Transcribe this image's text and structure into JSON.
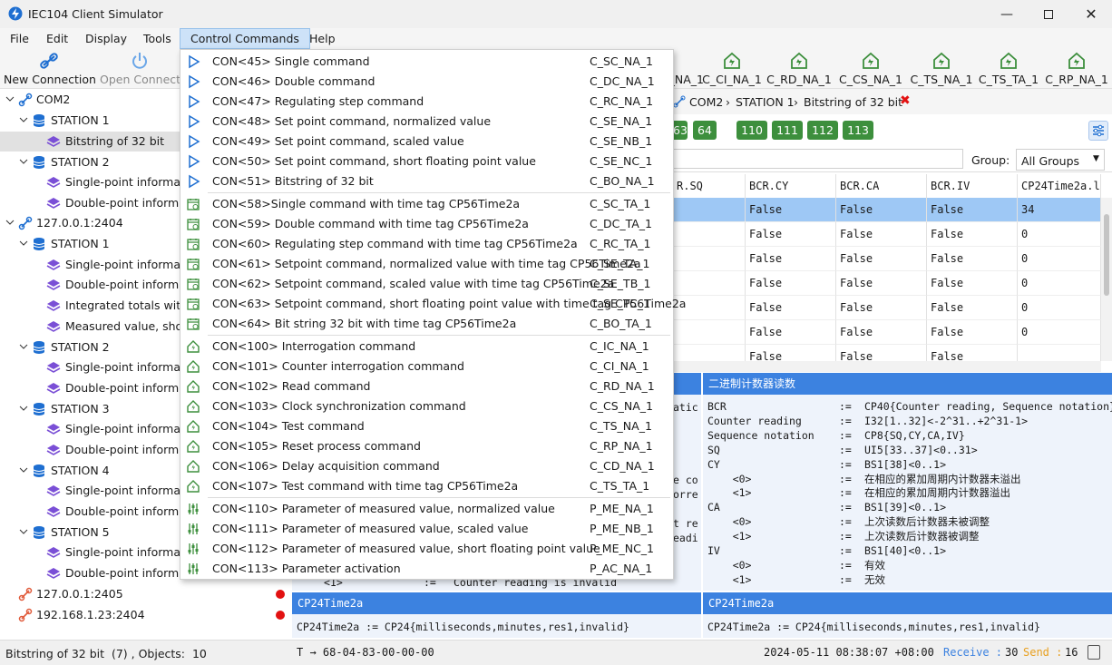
{
  "window": {
    "title": "IEC104 Client Simulator"
  },
  "menubar": {
    "items": [
      "File",
      "Edit",
      "Display",
      "Tools",
      "Control Commands",
      "Help"
    ]
  },
  "toolbar": {
    "new_connection": "New Connection",
    "open_connection": "Open Connect",
    "right_buttons": [
      "_NA_1",
      "C_CI_NA_1",
      "C_RD_NA_1",
      "C_CS_NA_1",
      "C_TS_NA_1",
      "C_TS_TA_1",
      "C_RP_NA_1"
    ]
  },
  "tree": {
    "com2": "COM2",
    "com2_station1": "STATION 1",
    "com2_station1_bitstring": "Bitstring of 32 bit",
    "com2_station2": "STATION 2",
    "com2_station2_items": [
      "Single-point informati",
      "Double-point informa"
    ],
    "conn1": "127.0.0.1:2404",
    "c1_st1": "STATION 1",
    "c1_st1_items": [
      "Single-point informati",
      "Double-point informa",
      "Integrated totals with",
      "Measured value, short"
    ],
    "c1_st2": "STATION 2",
    "c1_st2_items": [
      "Single-point informati",
      "Double-point informa"
    ],
    "c1_st3": "STATION 3",
    "c1_st3_items": [
      "Single-point informati",
      "Double-point informa"
    ],
    "c1_st4": "STATION 4",
    "c1_st4_items": [
      "Single-point informati",
      "Double-point informa"
    ],
    "c1_st5": "STATION 5",
    "c1_st5_items": [
      "Single-point informati",
      "Double-point informa"
    ],
    "conn2": "127.0.0.1:2405",
    "conn3": "192.168.1.23:2404"
  },
  "breadcrumb": {
    "root": "COM2",
    "station": "STATION 1",
    "leaf": "Bitstring of 32 bit"
  },
  "type_buttons": [
    "63",
    "64",
    "110",
    "111",
    "112",
    "113"
  ],
  "filter": {
    "group_label": "Group:",
    "group_value": "All Groups"
  },
  "grid": {
    "columns": [
      "R.SQ",
      "BCR.CY",
      "BCR.CA",
      "BCR.IV",
      "CP24Time2a.l"
    ],
    "rows": [
      [
        "",
        "False",
        "False",
        "False",
        "34"
      ],
      [
        "",
        "False",
        "False",
        "False",
        "0"
      ],
      [
        "",
        "False",
        "False",
        "False",
        "0"
      ],
      [
        "",
        "False",
        "False",
        "False",
        "0"
      ],
      [
        "",
        "False",
        "False",
        "False",
        "0"
      ],
      [
        "",
        "False",
        "False",
        "False",
        "0"
      ],
      [
        "",
        "False",
        "False",
        "False",
        ""
      ]
    ]
  },
  "detail": {
    "left_fragments": [
      "atic",
      "e co",
      "orre",
      "t re",
      "eadi"
    ],
    "left_bottom": [
      "<1>",
      ":=",
      "Counter reading is invalid"
    ],
    "right_header": "二进制计数器读数",
    "right_lines": [
      [
        "BCR",
        ":=",
        "CP40{Counter reading, Sequence notation}"
      ],
      [
        "Counter reading",
        ":=",
        "I32[1..32]<-2^31..+2^31-1>"
      ],
      [
        "Sequence notation",
        ":=",
        "CP8{SQ,CY,CA,IV}"
      ],
      [
        "SQ",
        ":=",
        "UI5[33..37]<0..31>"
      ],
      [
        "CY",
        ":=",
        "BS1[38]<0..1>"
      ],
      [
        "    <0>",
        ":=",
        "在相应的累加周期内计数器未溢出"
      ],
      [
        "    <1>",
        ":=",
        "在相应的累加周期内计数器溢出"
      ],
      [
        "CA",
        ":=",
        "BS1[39]<0..1>"
      ],
      [
        "    <0>",
        ":=",
        "上次读数后计数器未被调整"
      ],
      [
        "    <1>",
        ":=",
        "上次读数后计数器被调整"
      ],
      [
        "IV",
        ":=",
        "BS1[40]<0..1>"
      ],
      [
        "    <0>",
        ":=",
        "有效"
      ],
      [
        "    <1>",
        ":=",
        "无效"
      ]
    ],
    "cp_header": "CP24Time2a",
    "cp_text": "CP24Time2a := CP24{milliseconds,minutes,res1,invalid}"
  },
  "statusbar": {
    "selection": "Bitstring of 32 bit  (7) , Objects:  10",
    "frame": "T → 68-04-83-00-00-00",
    "datetime": "2024-05-11 08:38:07 +08:00",
    "receive_label": "Receive :",
    "receive_count": "30",
    "send_label": "Send :",
    "send_count": "16"
  },
  "colors": {
    "accent": "#3c82e0",
    "green": "#3d8f3d",
    "status_red": "#e21111",
    "receive": "#3c82e0",
    "send": "#e8a020"
  },
  "dropdown": {
    "items": [
      {
        "label": "CON<45> Single command",
        "code": "C_SC_NA_1",
        "icon": "play-icon"
      },
      {
        "label": "CON<46> Double command",
        "code": "C_DC_NA_1",
        "icon": "play-icon"
      },
      {
        "label": "CON<47> Regulating step command",
        "code": "C_RC_NA_1",
        "icon": "play-icon"
      },
      {
        "label": "CON<48> Set point command, normalized value",
        "code": "C_SE_NA_1",
        "icon": "play-icon"
      },
      {
        "label": "CON<49> Set point command, scaled value",
        "code": "C_SE_NB_1",
        "icon": "play-icon"
      },
      {
        "label": "CON<50> Set point command, short floating point value",
        "code": "C_SE_NC_1",
        "icon": "play-icon"
      },
      {
        "label": "CON<51> Bitstring of 32 bit",
        "code": "C_BO_NA_1",
        "icon": "play-icon"
      },
      {
        "label": "CON<58>Single command with time tag CP56Time2a",
        "code": "C_SC_TA_1",
        "icon": "calendar-icon"
      },
      {
        "label": "CON<59> Double command with time tag CP56Time2a",
        "code": "C_DC_TA_1",
        "icon": "calendar-icon"
      },
      {
        "label": "CON<60> Regulating step command with time tag CP56Time2a",
        "code": "C_RC_TA_1",
        "icon": "calendar-icon"
      },
      {
        "label": "CON<61> Setpoint command, normalized value with time tag CP56Time2a",
        "code": "C_SE_TA_1",
        "icon": "calendar-icon"
      },
      {
        "label": "CON<62> Setpoint command, scaled value with time tag CP56Time2a",
        "code": "C_SE_TB_1",
        "icon": "calendar-icon"
      },
      {
        "label": "CON<63> Setpoint command, short floating point value with time tag CP56Time2a",
        "code": "C_SE_TC_1",
        "icon": "calendar-icon"
      },
      {
        "label": "CON<64> Bit string 32 bit with time tag CP56Time2a",
        "code": "C_BO_TA_1",
        "icon": "calendar-icon"
      },
      {
        "label": "CON<100> Interrogation command",
        "code": "C_IC_NA_1",
        "icon": "house-icon"
      },
      {
        "label": "CON<101> Counter interrogation command",
        "code": "C_CI_NA_1",
        "icon": "house-icon"
      },
      {
        "label": "CON<102> Read command",
        "code": "C_RD_NA_1",
        "icon": "house-icon"
      },
      {
        "label": "CON<103> Clock synchronization command",
        "code": "C_CS_NA_1",
        "icon": "house-icon"
      },
      {
        "label": "CON<104> Test command",
        "code": "C_TS_NA_1",
        "icon": "house-icon"
      },
      {
        "label": "CON<105> Reset process command",
        "code": "C_RP_NA_1",
        "icon": "house-icon"
      },
      {
        "label": "CON<106> Delay acquisition command",
        "code": "C_CD_NA_1",
        "icon": "house-icon"
      },
      {
        "label": "CON<107> Test command with time tag CP56Time2a",
        "code": "C_TS_TA_1",
        "icon": "house-icon"
      },
      {
        "label": "CON<110> Parameter of measured value, normalized value",
        "code": "P_ME_NA_1",
        "icon": "sliders-icon"
      },
      {
        "label": "CON<111> Parameter of measured value, scaled value",
        "code": "P_ME_NB_1",
        "icon": "sliders-icon"
      },
      {
        "label": "CON<112> Parameter of measured value, short floating point value",
        "code": "P_ME_NC_1",
        "icon": "sliders-icon"
      },
      {
        "label": "CON<113> Parameter activation",
        "code": "P_AC_NA_1",
        "icon": "sliders-icon"
      }
    ]
  }
}
